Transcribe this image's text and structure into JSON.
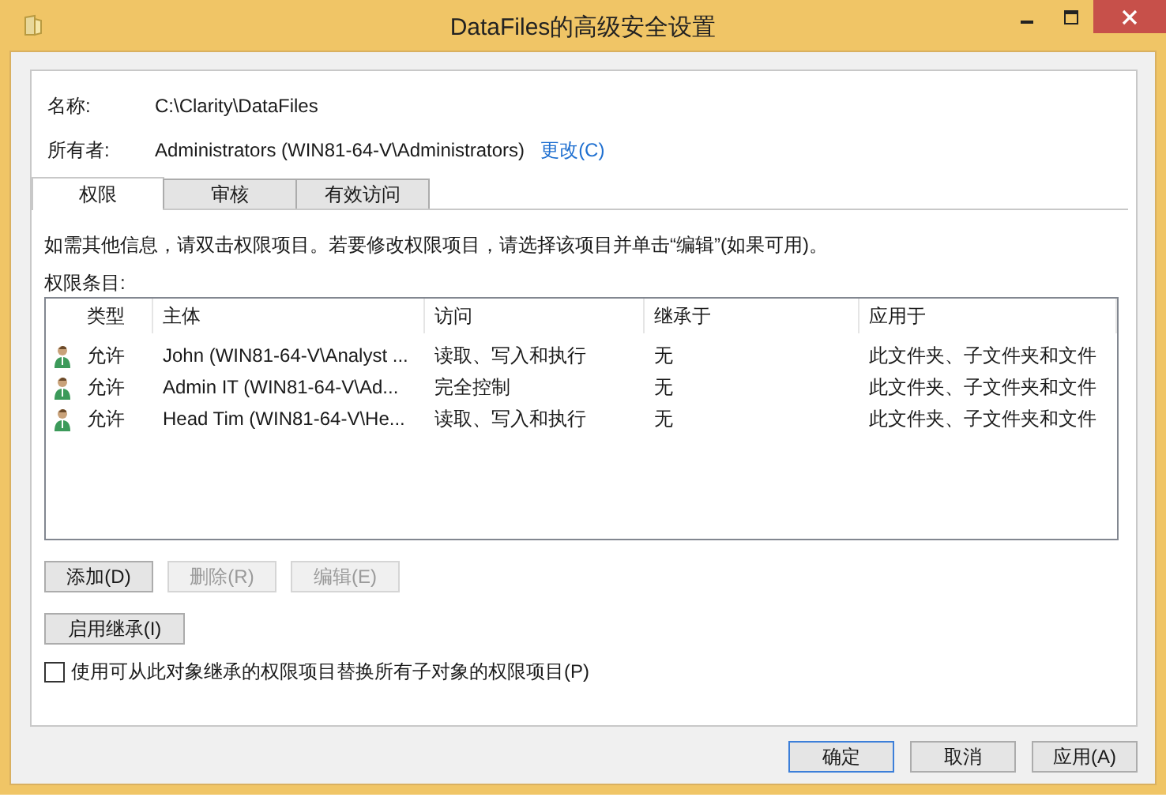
{
  "window": {
    "title": "DataFiles的高级安全设置"
  },
  "name": {
    "label": "名称:",
    "value": "C:\\Clarity\\DataFiles"
  },
  "owner": {
    "label": "所有者:",
    "value": "Administrators (WIN81-64-V\\Administrators)",
    "link": "更改(C)"
  },
  "tabs": [
    {
      "label": "权限",
      "selected": true
    },
    {
      "label": "审核",
      "selected": false
    },
    {
      "label": "有效访问",
      "selected": false
    }
  ],
  "info": "如需其他信息，请双击权限项目。若要修改权限项目，请选择该项目并单击“编辑”(如果可用)。",
  "entries_label": "权限条目:",
  "table": {
    "columns": [
      "类型",
      "主体",
      "访问",
      "继承于",
      "应用于"
    ],
    "rows": [
      {
        "type": "允许",
        "principal": "John (WIN81-64-V\\Analyst ...",
        "access": "读取、写入和执行",
        "inherited_from": "无",
        "applies_to": "此文件夹、子文件夹和文件"
      },
      {
        "type": "允许",
        "principal": "Admin IT (WIN81-64-V\\Ad...",
        "access": "完全控制",
        "inherited_from": "无",
        "applies_to": "此文件夹、子文件夹和文件"
      },
      {
        "type": "允许",
        "principal": "Head Tim (WIN81-64-V\\He...",
        "access": "读取、写入和执行",
        "inherited_from": "无",
        "applies_to": "此文件夹、子文件夹和文件"
      }
    ]
  },
  "entry_buttons": [
    {
      "label": "添加(D)",
      "disabled": false
    },
    {
      "label": "删除(R)",
      "disabled": true
    },
    {
      "label": "编辑(E)",
      "disabled": true
    }
  ],
  "inherit_button": {
    "label": "启用继承(I)"
  },
  "replace_checkbox": {
    "label": "使用可从此对象继承的权限项目替换所有子对象的权限项目(P)",
    "checked": false
  },
  "footer_buttons": [
    {
      "label": "确定",
      "default": true
    },
    {
      "label": "取消",
      "default": false
    },
    {
      "label": "应用(A)",
      "default": false
    }
  ]
}
